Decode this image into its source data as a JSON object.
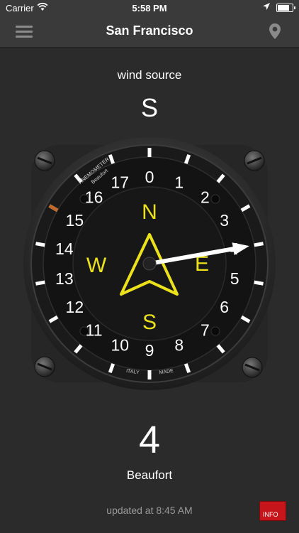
{
  "status_bar": {
    "carrier": "Carrier",
    "time": "5:58 PM",
    "battery_level": 0.9
  },
  "nav": {
    "title": "San Francisco",
    "menu_icon": "hamburger-menu-icon",
    "location_icon": "location-pin-icon"
  },
  "wind": {
    "source_label": "wind source",
    "source_value": "S",
    "beaufort_value": "4",
    "beaufort_unit": "Beaufort",
    "updated_text": "updated at 8:45 AM"
  },
  "gauge": {
    "brand_line1": "ANEMOMETER",
    "brand_line2": "Beaufort",
    "made_left": "ITALY",
    "made_right": "MADE",
    "scale_labels": [
      "0",
      "1",
      "2",
      "3",
      "4",
      "5",
      "6",
      "7",
      "8",
      "9",
      "10",
      "11",
      "12",
      "13",
      "14",
      "15",
      "16",
      "17"
    ],
    "compass": {
      "north": "N",
      "east": "E",
      "south": "S",
      "west": "W"
    },
    "needle_value": 4,
    "colors": {
      "face": "#161616",
      "compass": "#ece21b",
      "needle": "#ffffff",
      "accent": "#c0672a"
    }
  },
  "info_button": {
    "label": "INFO",
    "color": "#c6161b"
  }
}
